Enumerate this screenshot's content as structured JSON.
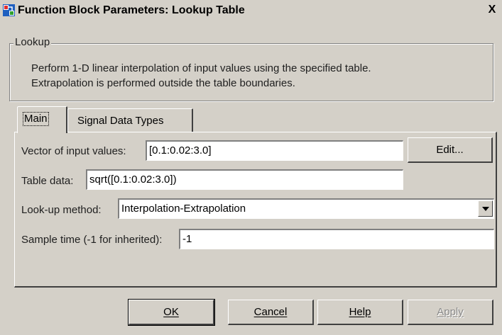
{
  "window": {
    "title": "Function Block Parameters: Lookup Table",
    "close_label": "X",
    "title_icon": "simulink-block-icon",
    "colors": {
      "face": "#d4d0c8",
      "field_background": "#ffffff",
      "disabled_text": "#8a8a8a"
    }
  },
  "description": {
    "group_label": "Lookup",
    "line1": "Perform 1-D linear interpolation of input values using the specified table.",
    "line2": "Extrapolation is performed outside the table boundaries."
  },
  "tabs": [
    {
      "label": "Main",
      "selected": true
    },
    {
      "label": "Signal Data Types",
      "selected": false
    }
  ],
  "params": {
    "input_values_label": "Vector of input values:",
    "input_values": "[0.1:0.02:3.0]",
    "edit_label": "Edit...",
    "table_data_label": "Table data:",
    "table_data": "sqrt([0.1:0.02:3.0])",
    "lookup_method_label": "Look-up method:",
    "lookup_method": "Interpolation-Extrapolation",
    "sample_time_label": "Sample time (-1 for inherited):",
    "sample_time": "-1"
  },
  "buttons": {
    "ok": "OK",
    "cancel": "Cancel",
    "help": "Help",
    "apply": "Apply",
    "apply_enabled": false
  }
}
